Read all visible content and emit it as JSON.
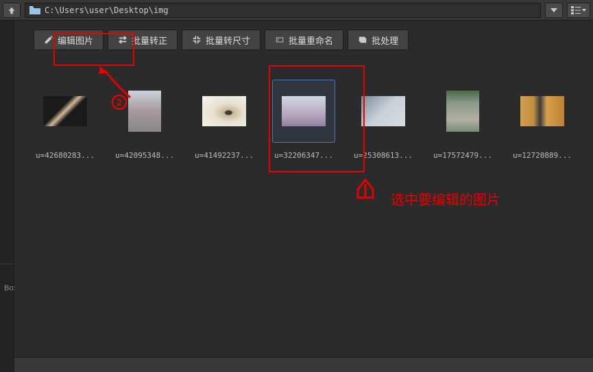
{
  "topbar": {
    "path": "C:\\Users\\user\\Desktop\\img"
  },
  "sidebar": {
    "box_label": "Box"
  },
  "toolbar": {
    "edit_image": "编辑图片",
    "batch_convert": "批量转正",
    "batch_resize": "批量转尺寸",
    "batch_rename": "批量重命名",
    "batch_process": "批处理"
  },
  "thumbnails": [
    {
      "label": "u=42680283...",
      "selected": false,
      "tall": false,
      "imgClass": "img-1"
    },
    {
      "label": "u=42095348...",
      "selected": false,
      "tall": true,
      "imgClass": "img-2"
    },
    {
      "label": "u=41492237...",
      "selected": false,
      "tall": false,
      "imgClass": "img-3"
    },
    {
      "label": "u=32206347...",
      "selected": true,
      "tall": false,
      "imgClass": "img-4"
    },
    {
      "label": "u=25308613...",
      "selected": false,
      "tall": false,
      "imgClass": "img-5"
    },
    {
      "label": "u=17572479...",
      "selected": false,
      "tall": true,
      "imgClass": "img-6"
    },
    {
      "label": "u=12720889...",
      "selected": false,
      "tall": false,
      "imgClass": "img-7"
    }
  ],
  "annotations": {
    "step1_text": "选中要编辑的图片",
    "color": "#e60000"
  }
}
